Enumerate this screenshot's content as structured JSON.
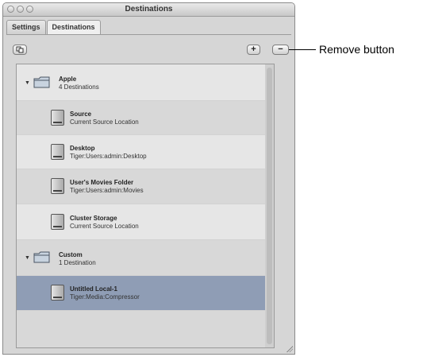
{
  "window": {
    "title": "Destinations"
  },
  "tabs": [
    {
      "label": "Settings",
      "active": false
    },
    {
      "label": "Destinations",
      "active": true
    }
  ],
  "toolbar": {
    "duplicate_icon": "duplicate-icon",
    "add_label": "+",
    "remove_label": "−"
  },
  "groups": [
    {
      "name": "Apple",
      "count_label": "4 Destinations",
      "items": [
        {
          "name": "Source",
          "path": "Current Source Location"
        },
        {
          "name": "Desktop",
          "path": "Tiger:Users:admin:Desktop"
        },
        {
          "name": "User's Movies Folder",
          "path": "Tiger:Users:admin:Movies"
        },
        {
          "name": "Cluster Storage",
          "path": "Current Source Location"
        }
      ]
    },
    {
      "name": "Custom",
      "count_label": "1 Destination",
      "items": [
        {
          "name": "Untitled Local-1",
          "path": "Tiger:Media:Compressor",
          "selected": true
        }
      ]
    }
  ],
  "callout": {
    "label": "Remove button"
  },
  "colors": {
    "selection": "#8f9db5",
    "list_bg": "#e6e6e6",
    "window_bg": "#d6d6d6"
  }
}
